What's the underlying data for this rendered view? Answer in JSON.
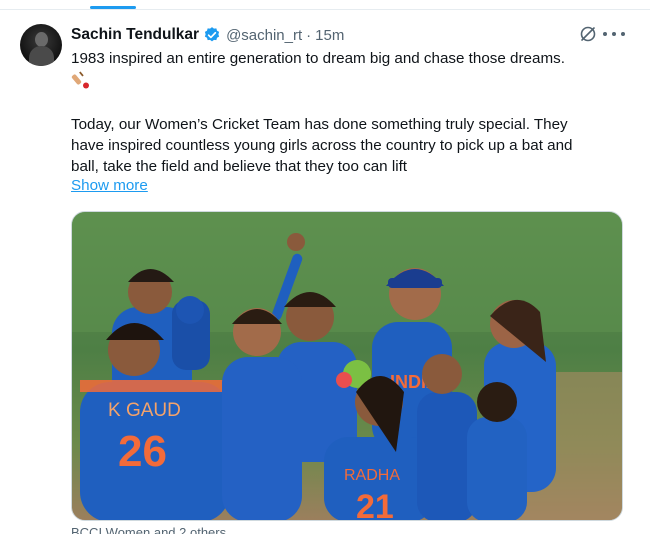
{
  "tweet": {
    "author_name": "Sachin Tendulkar",
    "author_handle": "@sachin_rt",
    "separator": "·",
    "time": "15m",
    "line1": "1983 inspired an entire generation to dream big and chase those dreams.",
    "para2_lines": [
      "Today, our Women’s Cricket Team has done something truly special. They",
      "have inspired countless young girls across the country to pick up a bat and",
      "ball, take the field and believe that they too can lift"
    ],
    "show_more": "Show more",
    "media_caption": "BCCI Women and 2 others"
  },
  "media": {
    "jersey_names": [
      "K GAUD",
      "RADHA"
    ],
    "jersey_numbers": [
      "26",
      "21"
    ],
    "chest_text": "INDIA"
  },
  "colors": {
    "accent": "#1d9bf0",
    "text": "#0f1419",
    "muted": "#536471",
    "jersey_blue": "#1f5fbf",
    "jersey_orange": "#f26b3a"
  },
  "icons": {
    "verified": "verified-badge-icon",
    "grok": "grok-icon",
    "more": "more-options-icon",
    "emoji": "cricket-bat-emoji-icon"
  }
}
